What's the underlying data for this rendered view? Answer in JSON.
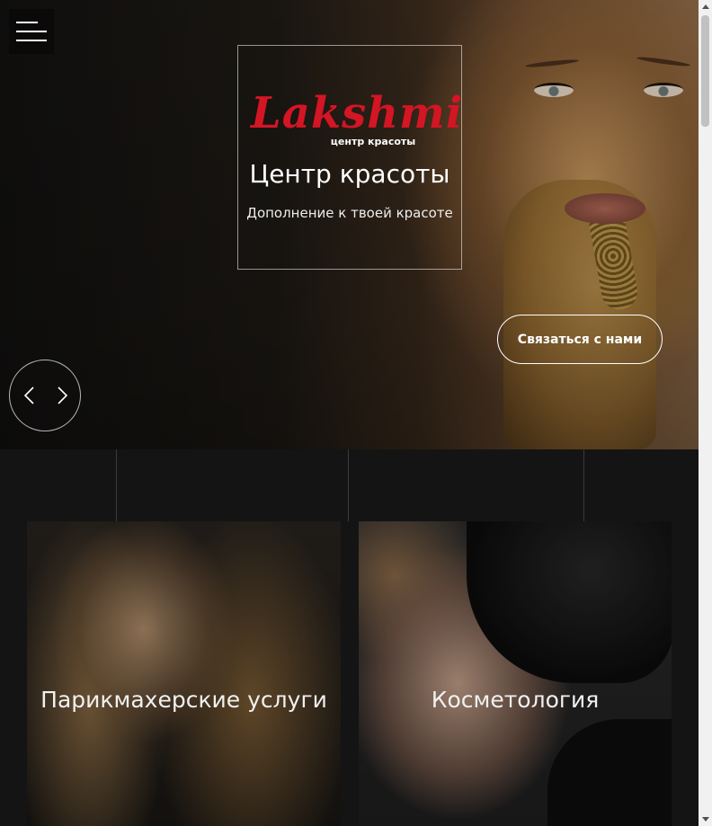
{
  "header": {
    "menu_icon": "hamburger-menu-icon"
  },
  "brand": {
    "logo_wordmark": "Lakshmi",
    "logo_tagline": "центр красоты",
    "title": "Центр красоты",
    "subtitle": "Дополнение к твоей красоте"
  },
  "hero": {
    "cta_label": "Связаться с нами",
    "prev_icon": "chevron-left-icon",
    "next_icon": "chevron-right-icon"
  },
  "services": [
    {
      "title": "Парикмахерские услуги"
    },
    {
      "title": "Косметология"
    }
  ],
  "colors": {
    "background": "#141414",
    "logo_red": "#d41524",
    "text": "#ffffff"
  }
}
